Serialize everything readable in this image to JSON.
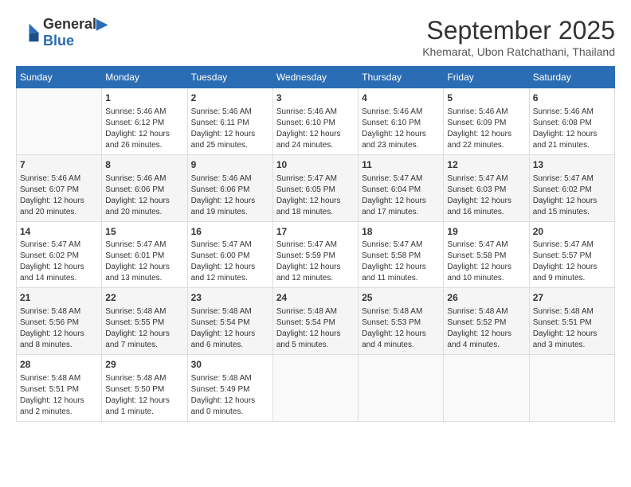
{
  "logo": {
    "line1": "General",
    "line2": "Blue"
  },
  "title": "September 2025",
  "location": "Khemarat, Ubon Ratchathani, Thailand",
  "headers": [
    "Sunday",
    "Monday",
    "Tuesday",
    "Wednesday",
    "Thursday",
    "Friday",
    "Saturday"
  ],
  "weeks": [
    [
      {
        "day": "",
        "info": ""
      },
      {
        "day": "1",
        "info": "Sunrise: 5:46 AM\nSunset: 6:12 PM\nDaylight: 12 hours\nand 26 minutes."
      },
      {
        "day": "2",
        "info": "Sunrise: 5:46 AM\nSunset: 6:11 PM\nDaylight: 12 hours\nand 25 minutes."
      },
      {
        "day": "3",
        "info": "Sunrise: 5:46 AM\nSunset: 6:10 PM\nDaylight: 12 hours\nand 24 minutes."
      },
      {
        "day": "4",
        "info": "Sunrise: 5:46 AM\nSunset: 6:10 PM\nDaylight: 12 hours\nand 23 minutes."
      },
      {
        "day": "5",
        "info": "Sunrise: 5:46 AM\nSunset: 6:09 PM\nDaylight: 12 hours\nand 22 minutes."
      },
      {
        "day": "6",
        "info": "Sunrise: 5:46 AM\nSunset: 6:08 PM\nDaylight: 12 hours\nand 21 minutes."
      }
    ],
    [
      {
        "day": "7",
        "info": "Sunrise: 5:46 AM\nSunset: 6:07 PM\nDaylight: 12 hours\nand 20 minutes."
      },
      {
        "day": "8",
        "info": "Sunrise: 5:46 AM\nSunset: 6:06 PM\nDaylight: 12 hours\nand 20 minutes."
      },
      {
        "day": "9",
        "info": "Sunrise: 5:46 AM\nSunset: 6:06 PM\nDaylight: 12 hours\nand 19 minutes."
      },
      {
        "day": "10",
        "info": "Sunrise: 5:47 AM\nSunset: 6:05 PM\nDaylight: 12 hours\nand 18 minutes."
      },
      {
        "day": "11",
        "info": "Sunrise: 5:47 AM\nSunset: 6:04 PM\nDaylight: 12 hours\nand 17 minutes."
      },
      {
        "day": "12",
        "info": "Sunrise: 5:47 AM\nSunset: 6:03 PM\nDaylight: 12 hours\nand 16 minutes."
      },
      {
        "day": "13",
        "info": "Sunrise: 5:47 AM\nSunset: 6:02 PM\nDaylight: 12 hours\nand 15 minutes."
      }
    ],
    [
      {
        "day": "14",
        "info": "Sunrise: 5:47 AM\nSunset: 6:02 PM\nDaylight: 12 hours\nand 14 minutes."
      },
      {
        "day": "15",
        "info": "Sunrise: 5:47 AM\nSunset: 6:01 PM\nDaylight: 12 hours\nand 13 minutes."
      },
      {
        "day": "16",
        "info": "Sunrise: 5:47 AM\nSunset: 6:00 PM\nDaylight: 12 hours\nand 12 minutes."
      },
      {
        "day": "17",
        "info": "Sunrise: 5:47 AM\nSunset: 5:59 PM\nDaylight: 12 hours\nand 12 minutes."
      },
      {
        "day": "18",
        "info": "Sunrise: 5:47 AM\nSunset: 5:58 PM\nDaylight: 12 hours\nand 11 minutes."
      },
      {
        "day": "19",
        "info": "Sunrise: 5:47 AM\nSunset: 5:58 PM\nDaylight: 12 hours\nand 10 minutes."
      },
      {
        "day": "20",
        "info": "Sunrise: 5:47 AM\nSunset: 5:57 PM\nDaylight: 12 hours\nand 9 minutes."
      }
    ],
    [
      {
        "day": "21",
        "info": "Sunrise: 5:48 AM\nSunset: 5:56 PM\nDaylight: 12 hours\nand 8 minutes."
      },
      {
        "day": "22",
        "info": "Sunrise: 5:48 AM\nSunset: 5:55 PM\nDaylight: 12 hours\nand 7 minutes."
      },
      {
        "day": "23",
        "info": "Sunrise: 5:48 AM\nSunset: 5:54 PM\nDaylight: 12 hours\nand 6 minutes."
      },
      {
        "day": "24",
        "info": "Sunrise: 5:48 AM\nSunset: 5:54 PM\nDaylight: 12 hours\nand 5 minutes."
      },
      {
        "day": "25",
        "info": "Sunrise: 5:48 AM\nSunset: 5:53 PM\nDaylight: 12 hours\nand 4 minutes."
      },
      {
        "day": "26",
        "info": "Sunrise: 5:48 AM\nSunset: 5:52 PM\nDaylight: 12 hours\nand 4 minutes."
      },
      {
        "day": "27",
        "info": "Sunrise: 5:48 AM\nSunset: 5:51 PM\nDaylight: 12 hours\nand 3 minutes."
      }
    ],
    [
      {
        "day": "28",
        "info": "Sunrise: 5:48 AM\nSunset: 5:51 PM\nDaylight: 12 hours\nand 2 minutes."
      },
      {
        "day": "29",
        "info": "Sunrise: 5:48 AM\nSunset: 5:50 PM\nDaylight: 12 hours\nand 1 minute."
      },
      {
        "day": "30",
        "info": "Sunrise: 5:48 AM\nSunset: 5:49 PM\nDaylight: 12 hours\nand 0 minutes."
      },
      {
        "day": "",
        "info": ""
      },
      {
        "day": "",
        "info": ""
      },
      {
        "day": "",
        "info": ""
      },
      {
        "day": "",
        "info": ""
      }
    ]
  ]
}
